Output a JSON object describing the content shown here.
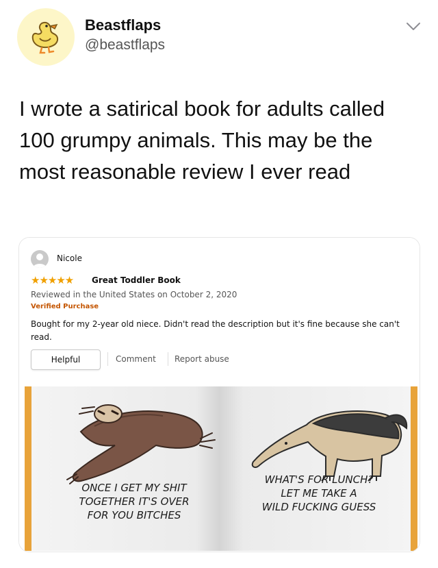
{
  "tweet": {
    "display_name": "Beastflaps",
    "handle": "@beastflaps",
    "avatar_icon": "duck-icon",
    "menu_icon": "chevron-down-icon",
    "text": "I wrote a satirical book for adults called 100 grumpy animals. This may be the most reasonable review I ever read"
  },
  "review": {
    "reviewer": "Nicole",
    "rating": 5,
    "stars": "★★★★★",
    "title": "Great Toddler Book",
    "meta": "Reviewed in the United States on October 2, 2020",
    "verified": "Verified Purchase",
    "body": "Bought for my 2-year old niece. Didn't read the description but it's fine because she can't read.",
    "helpful_label": "Helpful",
    "comment_label": "Comment",
    "report_label": "Report abuse",
    "star_color": "#f0a000",
    "verified_color": "#c45500"
  },
  "book": {
    "left_caption": [
      "ONCE I GET MY SHIT",
      "TOGETHER IT'S OVER",
      "FOR YOU BITCHES"
    ],
    "right_caption": [
      "WHAT'S FOR LUNCH?",
      "LET ME TAKE A",
      "WILD FUCKING GUESS"
    ],
    "left_animal": "sloth-illustration",
    "right_animal": "anteater-illustration",
    "page_accent": "#e8a33a"
  }
}
